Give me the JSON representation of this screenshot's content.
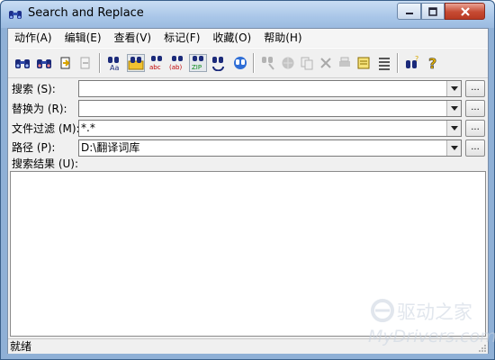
{
  "window": {
    "title": "Search and Replace",
    "icons": {
      "app": "binoculars-icon",
      "minimize": "minimize-icon",
      "maximize": "maximize-icon",
      "close": "close-icon"
    }
  },
  "menu": {
    "items": [
      "动作(A)",
      "编辑(E)",
      "查看(V)",
      "标记(F)",
      "收藏(O)",
      "帮助(H)"
    ]
  },
  "toolbar": {
    "buttons": [
      {
        "icon": "search-binoculars-icon",
        "enabled": true
      },
      {
        "icon": "search-replace-binoculars-icon",
        "enabled": true
      },
      {
        "icon": "open-file-icon",
        "enabled": true
      },
      {
        "icon": "move-icon",
        "enabled": false
      },
      {
        "icon": "font-search-icon",
        "enabled": true
      },
      {
        "icon": "search-folder-icon",
        "enabled": true,
        "active": true
      },
      {
        "icon": "replace-abc-icon",
        "enabled": true
      },
      {
        "icon": "replace-ab-icon",
        "enabled": true
      },
      {
        "icon": "zip-search-icon",
        "enabled": true,
        "active": true
      },
      {
        "icon": "refresh-icon",
        "enabled": true
      },
      {
        "icon": "web-search-icon",
        "enabled": true
      },
      {
        "icon": "find-disabled-icon",
        "enabled": false
      },
      {
        "icon": "globe-icon",
        "enabled": false
      },
      {
        "icon": "copy-icon",
        "enabled": false
      },
      {
        "icon": "delete-x-icon",
        "enabled": false
      },
      {
        "icon": "print-icon",
        "enabled": false
      },
      {
        "icon": "scroll-icon",
        "enabled": true
      },
      {
        "icon": "list-icon",
        "enabled": true
      },
      {
        "icon": "help-search-icon",
        "enabled": true
      },
      {
        "icon": "question-mark-icon",
        "enabled": true
      }
    ]
  },
  "form": {
    "search": {
      "label": "搜索 (S):",
      "value": ""
    },
    "replace": {
      "label": "替换为 (R):",
      "value": ""
    },
    "filter": {
      "label": "文件过滤 (M):",
      "value": "*.*"
    },
    "path": {
      "label": "路径 (P):",
      "value": "D:\\翻译词库"
    },
    "browse_label": "...",
    "results_label": "搜索结果 (U):"
  },
  "status": {
    "text": "就绪"
  },
  "watermark": {
    "cn": "驱动之家",
    "en": "MyDrivers.com"
  }
}
